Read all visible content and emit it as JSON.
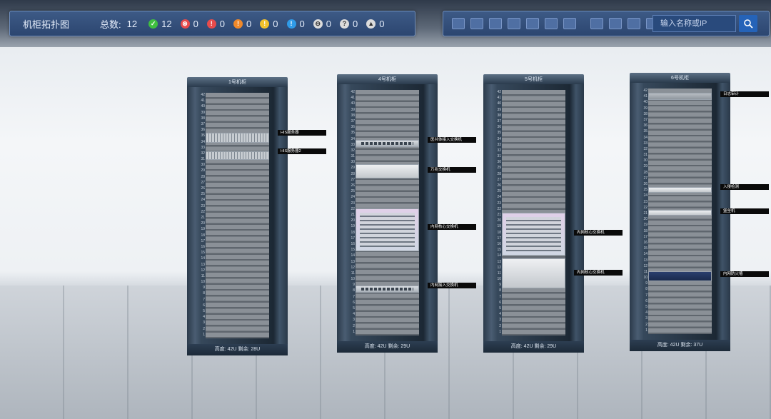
{
  "header": {
    "title": "机柜拓扑图",
    "total_label": "总数:",
    "total_value": "12",
    "stats": [
      {
        "icon": "check-icon",
        "color": "#3fbf3f",
        "glyph": "✓",
        "value": "12"
      },
      {
        "icon": "error-icon",
        "color": "#e84b4b",
        "glyph": "⊗",
        "value": "0"
      },
      {
        "icon": "alert-icon",
        "color": "#e84b4b",
        "glyph": "!",
        "value": "0"
      },
      {
        "icon": "warning-icon",
        "color": "#f0892a",
        "glyph": "!",
        "value": "0"
      },
      {
        "icon": "caution-icon",
        "color": "#f2c12a",
        "glyph": "!",
        "value": "0"
      },
      {
        "icon": "info-icon",
        "color": "#2f9be8",
        "glyph": "!",
        "value": "0"
      },
      {
        "icon": "offline-icon",
        "color": "#dcdcdc",
        "glyph": "⊖",
        "value": "0"
      },
      {
        "icon": "unknown-icon",
        "color": "#dcdcdc",
        "glyph": "?",
        "value": "0"
      },
      {
        "icon": "unmanaged-icon",
        "color": "#dcdcdc",
        "glyph": "▲",
        "value": "0"
      }
    ],
    "search_placeholder": "输入名称或IP"
  },
  "racks": [
    {
      "name": "1号机柜",
      "footer": "高度: 42U   剩余: 28U",
      "devices": [
        {
          "label": "HIS服务器"
        },
        {
          "label": "HIS服务器2"
        }
      ]
    },
    {
      "name": "4号机柜",
      "footer": "高度: 42U   剩余: 29U",
      "devices": [
        {
          "label": "医共体接入交换机"
        },
        {
          "label": "万兆交换机"
        },
        {
          "label": "内网核心交换机"
        },
        {
          "label": "内网接入交换机"
        }
      ]
    },
    {
      "name": "5号机柜",
      "footer": "高度: 42U   剩余: 29U",
      "devices": [
        {
          "label": "内网核心交换机"
        },
        {
          "label": "内网核心交换机"
        }
      ]
    },
    {
      "name": "6号机柜",
      "footer": "高度: 42U   剩余: 37U",
      "devices": [
        {
          "label": "日志审计"
        },
        {
          "label": "入侵检测"
        },
        {
          "label": "堡垒机"
        },
        {
          "label": "内网防火墙"
        }
      ]
    }
  ]
}
